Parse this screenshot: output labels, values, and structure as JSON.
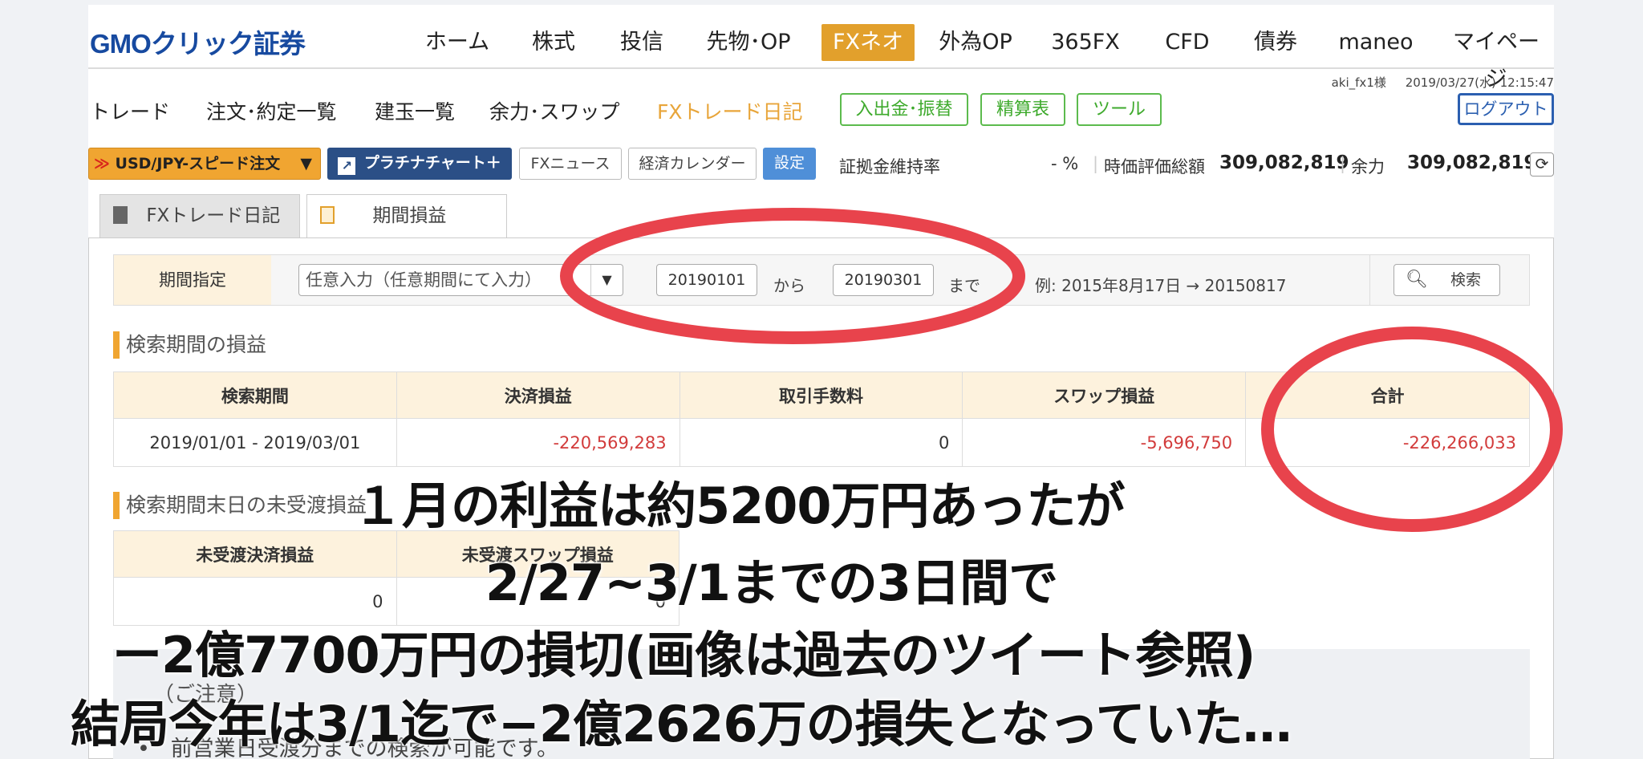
{
  "header": {
    "logo": "GMOクリック証券",
    "nav": [
      "ホーム",
      "株式",
      "投信",
      "先物･OP",
      "FXネオ",
      "外為OP",
      "365FX",
      "CFD",
      "債券",
      "maneo",
      "マイページ"
    ],
    "active_nav": "FXネオ"
  },
  "subnav": {
    "items": [
      "トレード",
      "注文･約定一覧",
      "建玉一覧",
      "余力･スワップ",
      "FXトレード日記"
    ],
    "active": "FXトレード日記",
    "green_buttons": [
      "入出金･振替",
      "精算表",
      "ツール"
    ],
    "user": "aki_fx1様",
    "datetime": "2019/03/27(水) 12:15:47",
    "logout": "ログアウト"
  },
  "toolbar": {
    "speed_order": "USD/JPY-スピード注文",
    "platinum_chart": "プラチナチャート＋",
    "fx_news": "FXニュース",
    "calendar": "経済カレンダー",
    "settings": "設定",
    "margin_label": "証拠金維持率",
    "margin_value": "- %",
    "valuation_label": "時価評価総額",
    "valuation_value": "309,082,819",
    "capacity_label": "余力",
    "capacity_value": "309,082,819"
  },
  "tabs": {
    "diary": "FXトレード日記",
    "period_pl": "期間損益"
  },
  "period": {
    "label": "期間指定",
    "select_value": "任意入力（任意期間にて入力）",
    "from_date": "20190101",
    "from_text": "から",
    "to_date": "20190301",
    "to_text": "まで",
    "example": "例: 2015年8月17日 → 20150817",
    "search": "検索"
  },
  "summary": {
    "title": "検索期間の損益",
    "headers": [
      "検索期間",
      "決済損益",
      "取引手数料",
      "スワップ損益",
      "合計"
    ],
    "row": [
      "2019/01/01 - 2019/03/01",
      "-220,569,283",
      "0",
      "-5,696,750",
      "-226,266,033"
    ]
  },
  "undelivered": {
    "title": "検索期間末日の未受渡損益",
    "headers": [
      "未受渡決済損益",
      "未受渡スワップ損益"
    ],
    "row": [
      "0",
      "0"
    ]
  },
  "notice": {
    "title": "（ご注意）",
    "line": "前営業日受渡分までの検索が可能です。"
  },
  "captions": [
    "１月の利益は約5200万円あったが",
    "2/27~3/1までの3日間で",
    "ー2億7700万円の損切(画像は過去のツイート参照)",
    "結局今年は3/1迄で−2億2626万の損失となっていた…"
  ],
  "colors": {
    "accent_orange": "#e2a02c",
    "negative_red": "#d23b3b",
    "annotation_red": "#e8434c",
    "brand_blue": "#174aa0"
  }
}
